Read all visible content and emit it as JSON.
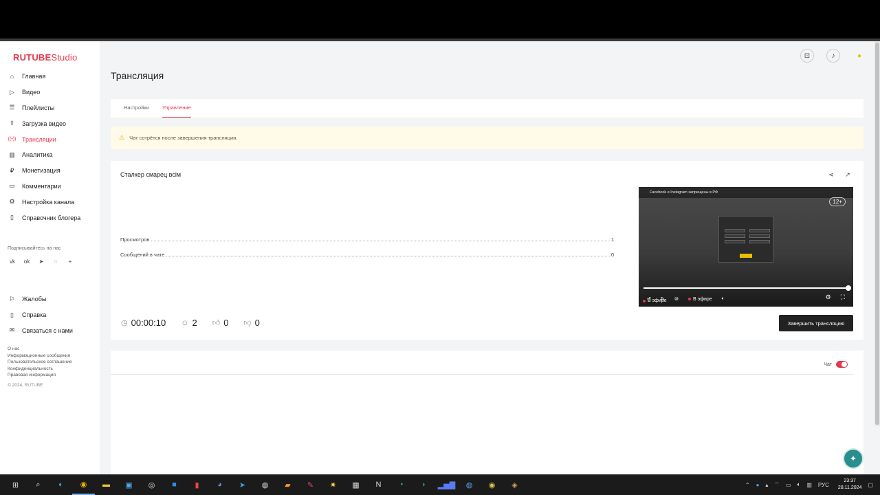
{
  "logo": {
    "rutube": "RUTUBE",
    "studio": "Studio"
  },
  "sidebar": {
    "items": [
      {
        "label": "Главная",
        "icon": "home-icon",
        "glyph": "⌂"
      },
      {
        "label": "Видео",
        "icon": "video-icon",
        "glyph": "▷"
      },
      {
        "label": "Плейлисты",
        "icon": "playlist-icon",
        "glyph": "☰"
      },
      {
        "label": "Загрузка видео",
        "icon": "upload-icon",
        "glyph": "⇪"
      },
      {
        "label": "Трансляции",
        "icon": "broadcast-icon",
        "glyph": "((•))"
      },
      {
        "label": "Аналитика",
        "icon": "analytics-icon",
        "glyph": "▥"
      },
      {
        "label": "Монетизация",
        "icon": "money-icon",
        "glyph": "₽"
      },
      {
        "label": "Комментарии",
        "icon": "comment-icon",
        "glyph": "▭"
      },
      {
        "label": "Настройка канала",
        "icon": "gear-icon",
        "glyph": "⚙"
      },
      {
        "label": "Справочник блогера",
        "icon": "book-icon",
        "glyph": "▯"
      }
    ],
    "follow_label": "Подписывайтесь на нас",
    "socials": [
      "vk-icon",
      "ok-icon",
      "telegram-icon",
      "viber-icon",
      "plus-icon"
    ],
    "secondary": [
      {
        "label": "Жалобы",
        "icon": "flag-icon",
        "glyph": "⚐"
      },
      {
        "label": "Справка",
        "icon": "help-book-icon",
        "glyph": "▯"
      },
      {
        "label": "Связаться с нами",
        "icon": "mail-icon",
        "glyph": "✉"
      }
    ],
    "footer": [
      "О нас",
      "Информационные сообщения",
      "Пользовательское соглашение",
      "Конфиденциальность",
      "Правовая информация"
    ],
    "copyright": "© 2024, RUTUBE"
  },
  "header": {
    "icons": [
      "add-video-icon",
      "bell-icon",
      "avatar-icon"
    ]
  },
  "page": {
    "title": "Трансляция",
    "tabs": [
      {
        "label": "Настройки"
      },
      {
        "label": "Управление"
      }
    ],
    "notice": "Чат сотрётся после завершения трансляции."
  },
  "stream": {
    "title": "Сталкер смарец всім",
    "stats": [
      {
        "label": "Просмотров",
        "value": "1"
      },
      {
        "label": "Сообщений в чате",
        "value": "0"
      }
    ],
    "metrics": {
      "duration": "00:00:10",
      "viewers": "2",
      "likes": "0",
      "dislikes": "0"
    },
    "end_button": "Завершить трансляцию"
  },
  "player": {
    "banner": "Facebook и Instagram запрещены в РФ",
    "age": "12+",
    "live_left": "В эфире",
    "live_right": "В эфире",
    "progress": 1.0
  },
  "chat": {
    "label": "Чат",
    "enabled": true
  },
  "taskbar": {
    "lang": "РУС",
    "time": "23:37",
    "date": "28.11.2024"
  },
  "colors": {
    "accent": "#e2394f",
    "warning_bg": "#fffbe8"
  }
}
